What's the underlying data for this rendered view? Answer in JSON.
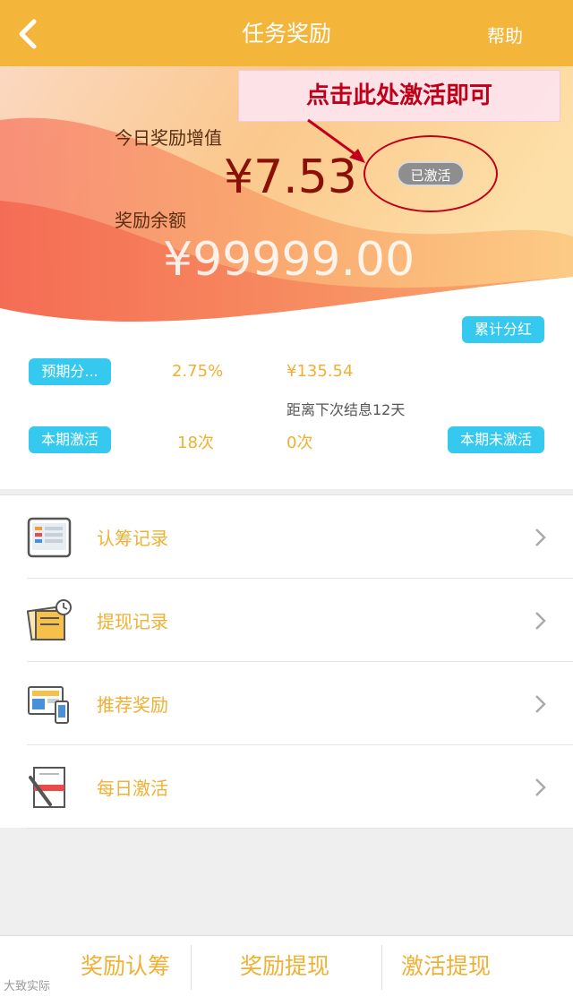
{
  "header": {
    "title": "任务奖励",
    "help": "帮助"
  },
  "annotation": {
    "text": "点击此处激活即可"
  },
  "hero": {
    "today_label": "今日奖励增值",
    "today_value": "¥7.53",
    "status_badge": "已激活",
    "balance_label": "奖励余额",
    "balance_value": "¥99999.00"
  },
  "stats": {
    "cumulative_btn": "累计分红",
    "expected_btn": "预期分...",
    "rate": "2.75%",
    "amount": "¥135.54",
    "next_settle": "距离下次结息12天",
    "current_active_btn": "本期激活",
    "active_count": "18次",
    "inactive_count": "0次",
    "current_inactive_btn": "本期未激活"
  },
  "menu": [
    {
      "label": "认筹记录",
      "icon": "tablet-icon"
    },
    {
      "label": "提现记录",
      "icon": "notes-clock-icon"
    },
    {
      "label": "推荐奖励",
      "icon": "devices-icon"
    },
    {
      "label": "每日激活",
      "icon": "book-pen-icon"
    }
  ],
  "tabs": [
    "奖励认筹",
    "奖励提现",
    "激活提现"
  ],
  "watermark": "大致实际",
  "colors": {
    "accent": "#f3b53a",
    "pill": "#35c9f0",
    "text_gold": "#efb033",
    "annotation_red": "#c0001a"
  }
}
